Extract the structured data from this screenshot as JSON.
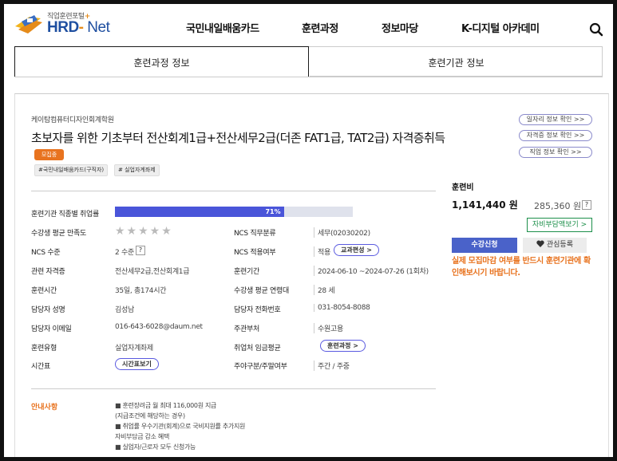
{
  "header": {
    "logo_sub": "직업훈련포털",
    "logo_plus": "+",
    "logo_hrd": "HRD",
    "logo_dash": "-",
    "logo_net": "Net",
    "nav": [
      "국민내일배움카드",
      "훈련과정",
      "정보마당",
      "K-디지털 아카데미"
    ],
    "search_icon": "search-icon"
  },
  "tabs": [
    "훈련과정 정보",
    "훈련기관 정보"
  ],
  "course": {
    "institution": "케이탐컴퓨터디자인회계학원",
    "title": "초보자를 위한 기초부터 전산회계1급+전산세무2급(더존 FAT1급, TAT2급) 자격증취득",
    "badge": "모집중",
    "tags": [
      "#국민내일배움카드(구직자)",
      "# 실업자계좌제"
    ]
  },
  "links": [
    "일자리 정보 확인 >>",
    "자격증 정보 확인 >>",
    "직업 정보 확인 >>"
  ],
  "details": {
    "employment_label": "훈련기관 직종별 취업률",
    "employment_rate_text": "71%",
    "employment_rate": 0.71,
    "satisfaction_label": "수강생 평균 만족도",
    "satisfaction_stars": 0,
    "stars": "★★★★★",
    "ncs_class_label": "NCS 직무분류",
    "ncs_class_value": "세무(02030202)",
    "ncs_level_label": "NCS 수준",
    "ncs_level_value": "2 수준",
    "help": "?",
    "ncs_apply_label": "NCS 적용여부",
    "ncs_apply_value": "적용",
    "curriculum_btn": "교과편성 >",
    "cert_label": "관련 자격증",
    "cert_value": "전산세무2급,전산회계1급",
    "period_label": "훈련기간",
    "period_value": "2024-06-10 ~2024-07-26 (1회차)",
    "hours_label": "훈련시간",
    "hours_value": "35일, 총174시간",
    "age_label": "수강생 평균 연령대",
    "age_value": "28 세",
    "manager_label": "담당자 성명",
    "manager_value": "김성남",
    "phone_label": "담당자 전화번호",
    "phone_value": "031-8054-8088",
    "email_label": "담당자 이메일",
    "email_value": "016-643-6028@daum.net",
    "dept_label": "주관부처",
    "dept_value": "수원고용",
    "type_label": "훈련유형",
    "type_value": "실업자계좌제",
    "wage_label": "취업처 임금평균",
    "wage_btn": "훈련과정 >",
    "schedule_label": "시간표",
    "schedule_btn": "시간표보기",
    "week_label": "주야구분/주말여부",
    "week_value": "주간 / 주중"
  },
  "fee": {
    "title": "훈련비",
    "price": "1,141,440 원",
    "self_pay": "285,360 원",
    "help": "?",
    "self_pay_btn": "자비부담액보기 >",
    "apply_btn": "수강신청",
    "fav_btn": "관심등록",
    "fav_icon": "heart-icon",
    "notice": "실제 모집마감 여부를 반드시 훈련기관에 확인해보시기 바랍니다."
  },
  "guide": {
    "label": "안내사항",
    "lines": [
      "■ 훈련장려금 월 최대 116,000원 지급",
      "(지급조건에 해당하는 경우)",
      "■ 취업률 우수기관(회계)으로 국비지원률 추가지원",
      "자비부담금 감소 혜택",
      "■ 실업자/근로자 모두 신청가능"
    ]
  },
  "colors": {
    "brand_blue": "#1f4fa0",
    "accent_orange": "#e8731f",
    "bar_fill": "#4a55d9",
    "apply_blue": "#4a62c9",
    "green": "#1c8f4a"
  }
}
